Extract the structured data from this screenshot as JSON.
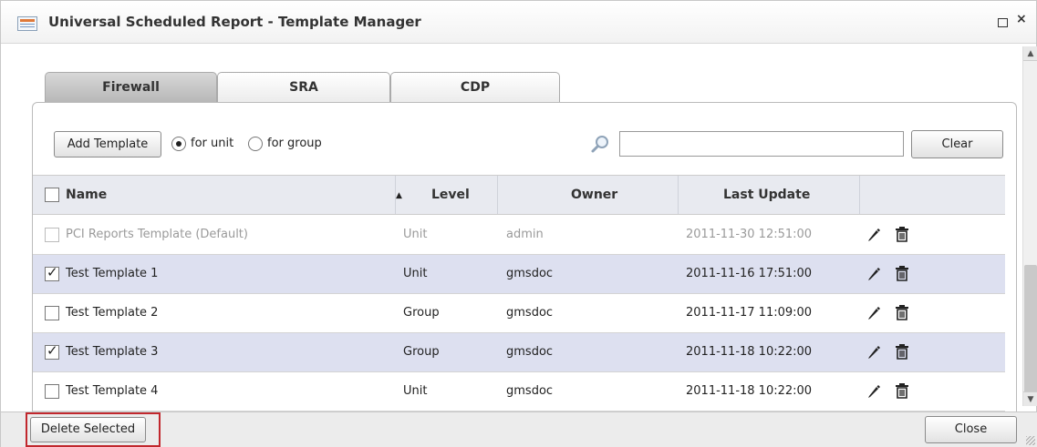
{
  "window": {
    "title": "Universal Scheduled Report - Template Manager",
    "maximize_icon": "maximize-icon",
    "close_glyph": "×"
  },
  "tabs": [
    {
      "label": "Firewall",
      "active": true
    },
    {
      "label": "SRA",
      "active": false
    },
    {
      "label": "CDP",
      "active": false
    }
  ],
  "toolbar": {
    "add_template_label": "Add Template",
    "radio_for_unit_label": "for unit",
    "radio_for_group_label": "for group",
    "selected_scope": "for unit",
    "search_value": "",
    "search_icon": "search-icon",
    "clear_label": "Clear"
  },
  "table": {
    "columns": [
      "Name",
      "Level",
      "Owner",
      "Last Update",
      ""
    ],
    "sort_indicator": "▲",
    "rows": [
      {
        "name": "PCI Reports Template (Default)",
        "level": "Unit",
        "owner": "admin",
        "last_update": "2011-11-30 12:51:00",
        "checked": false,
        "disabled": true
      },
      {
        "name": "Test Template 1",
        "level": "Unit",
        "owner": "gmsdoc",
        "last_update": "2011-11-16 17:51:00",
        "checked": true,
        "disabled": false
      },
      {
        "name": "Test Template 2",
        "level": "Group",
        "owner": "gmsdoc",
        "last_update": "2011-11-17 11:09:00",
        "checked": false,
        "disabled": false
      },
      {
        "name": "Test Template 3",
        "level": "Group",
        "owner": "gmsdoc",
        "last_update": "2011-11-18 10:22:00",
        "checked": true,
        "disabled": false
      },
      {
        "name": "Test Template 4",
        "level": "Unit",
        "owner": "gmsdoc",
        "last_update": "2011-11-18 10:22:00",
        "checked": false,
        "disabled": false
      }
    ]
  },
  "footer": {
    "delete_selected_label": "Delete Selected",
    "close_label": "Close"
  },
  "colors": {
    "selected_row": "#dde0f0",
    "header_bg": "#e8eaf0",
    "highlight_border": "#c1272d"
  }
}
